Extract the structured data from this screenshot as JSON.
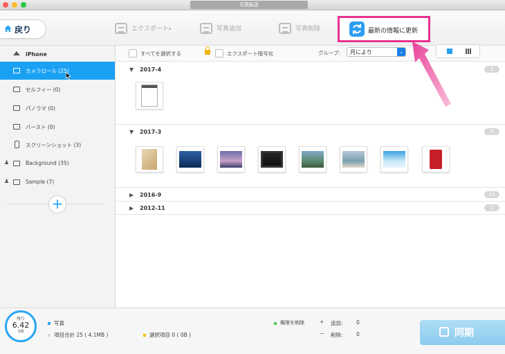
{
  "window": {
    "title": "写真転送"
  },
  "toolbar": {
    "back_label": "戻り",
    "export_label": "エクスポート",
    "add_label": "写真追加",
    "delete_label": "写真削除",
    "refresh_label": "最新の情報に更新"
  },
  "sidebar": {
    "device": "iPhone",
    "items": [
      {
        "label": "カメラロール (25)",
        "icon": "camera-icon",
        "active": true
      },
      {
        "label": "セルフィー (0)",
        "icon": "selfie-icon"
      },
      {
        "label": "パノラマ (0)",
        "icon": "panorama-icon"
      },
      {
        "label": "バースト (0)",
        "icon": "burst-icon"
      },
      {
        "label": "スクリーンショット (3)",
        "icon": "phone-icon"
      },
      {
        "label": "Background (35)",
        "icon": "album-icon"
      },
      {
        "label": "Sample (7)",
        "icon": "album-icon"
      }
    ]
  },
  "options": {
    "select_all": "すべてを選択する",
    "encrypt_export": "エクスポート暗号化",
    "group_label": "グループ:",
    "group_value": "月により"
  },
  "groups": [
    {
      "name": "2017-4",
      "count": "1",
      "expanded": true
    },
    {
      "name": "2017-3",
      "count": "8",
      "expanded": true
    },
    {
      "name": "2016-9",
      "count": "15",
      "expanded": false
    },
    {
      "name": "2012-11",
      "count": "1",
      "expanded": false
    }
  ],
  "status": {
    "gauge_top": "残り",
    "gauge_value": "6.42",
    "gauge_unit": "GB",
    "category": "写真",
    "total": "項目合計 25 ( 4.1MB )",
    "selected": "選択項目 0 ( 0B )",
    "remove_rights": "権限を削除",
    "add_label": "追加:",
    "add_value": "0",
    "del_label": "削除:",
    "del_value": "0",
    "sync_label": "同期"
  },
  "colors": {
    "accent": "#1aa1f4",
    "highlight": "#e8318e",
    "sync": "#8ccbee"
  }
}
